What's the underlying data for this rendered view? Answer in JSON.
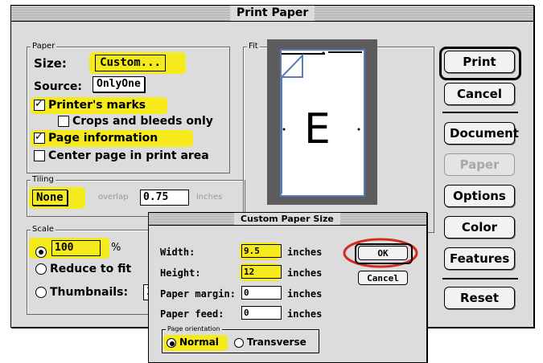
{
  "window": {
    "title": "Print Paper"
  },
  "paper_group": {
    "label": "Paper",
    "size_label": "Size:",
    "size_button": "Custom...",
    "source_label": "Source:",
    "source_value": "OnlyOne",
    "printers_marks": {
      "label": "Printer's marks",
      "checked": true
    },
    "crops_bleeds": {
      "label": "Crops and bleeds only",
      "checked": false
    },
    "page_information": {
      "label": "Page information",
      "checked": true
    },
    "center_page": {
      "label": "Center page in print area",
      "checked": false
    }
  },
  "tiling_group": {
    "label": "Tiling",
    "mode": "None",
    "overlap_label": "overlap",
    "overlap_value": "0.75",
    "units": "inches"
  },
  "scale_group": {
    "label": "Scale",
    "percent_value": "100",
    "percent_symbol": "%",
    "reduce_label": "Reduce to fit",
    "thumbnails_label": "Thumbnails:",
    "thumbnails_value": "1",
    "selected": "percent"
  },
  "fit_group": {
    "label": "Fit",
    "preview_letter": "E"
  },
  "buttons": {
    "print": "Print",
    "cancel": "Cancel",
    "document": "Document",
    "paper": "Paper",
    "options": "Options",
    "color": "Color",
    "features": "Features",
    "reset": "Reset"
  },
  "dialog": {
    "title": "Custom Paper Size",
    "width_label": "Width:",
    "width_value": "9.5",
    "height_label": "Height:",
    "height_value": "12",
    "margin_label": "Paper margin:",
    "margin_value": "0",
    "feed_label": "Paper feed:",
    "feed_value": "0",
    "units": "inches",
    "ok": "OK",
    "cancel": "Cancel",
    "orientation_label": "Page orientation",
    "normal": "Normal",
    "transverse": "Transverse",
    "orientation_selected": "Normal"
  },
  "colors": {
    "highlight": "#f5ea1c",
    "annotation_circle": "#d42a1f",
    "preview_outline": "#5a7ab8"
  }
}
